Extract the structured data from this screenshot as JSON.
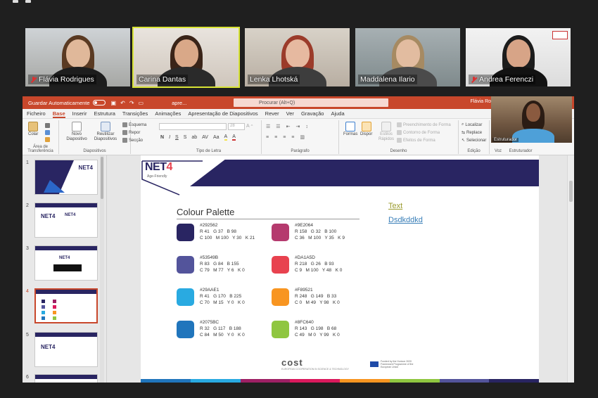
{
  "participants": [
    {
      "name": "Flávia Rodrigues",
      "muted": true
    },
    {
      "name": "Carina Dantas",
      "muted": false,
      "active": true
    },
    {
      "name": "Lenka Lhotská",
      "muted": false
    },
    {
      "name": "Maddalena Ilario",
      "muted": false
    },
    {
      "name": "Andrea Ferenczi",
      "muted": true
    }
  ],
  "ppt": {
    "autosave_label": "Guardar Automaticamente",
    "doc_name": "apre...",
    "search_placeholder": "Procurar (Alt+Q)",
    "user": "Flávia Rodrigues",
    "menu": [
      "Ficheiro",
      "Base",
      "Inserir",
      "Estrutura",
      "Transições",
      "Animações",
      "Apresentação de Diapositivos",
      "Rever",
      "Ver",
      "Gravação",
      "Ajuda"
    ],
    "active_menu": "Base",
    "ribbon": {
      "colar": "Colar",
      "clipboard_group": "Área de Transferência",
      "novo": "Novo Diapositivo",
      "reutilizar": "Reutilizar Diapositivos",
      "esquema": "Esquema",
      "repor": "Repor",
      "seccao": "Secção",
      "diapositivos_group": "Diapositivos",
      "font_size": "28",
      "tipo_letra_group": "Tipo de Letra",
      "paragrafo_group": "Parágrafo",
      "formas": "Formas",
      "dispor": "Dispor",
      "estilos": "Estilos Rápidos",
      "preenchimento": "Preenchimento de Forma",
      "contorno": "Contorno de Forma",
      "efeitos": "Efeitos de Forma",
      "desenho_group": "Desenho",
      "localizar": "Localizar",
      "replace": "Replace",
      "selecionar": "Selecionar",
      "edicao_group": "Edição",
      "voz_group": "Voz",
      "estruturador_group": "Estruturador"
    },
    "presenter_name": "Estruturador"
  },
  "thumbnails": [
    {
      "num": "1"
    },
    {
      "num": "2"
    },
    {
      "num": "3"
    },
    {
      "num": "4",
      "selected": true
    },
    {
      "num": "5"
    },
    {
      "num": "6"
    }
  ],
  "slide": {
    "logo": "NET",
    "logo_num": "4",
    "logo_sub": "Age-Friendly",
    "title": "Colour Palette",
    "link1": "Text",
    "link2": "Dsdkddkd",
    "cost_name": "cost",
    "cost_sub": "EUROPEAN COOPERATION IN SCIENCE & TECHNOLOGY",
    "eu_text": "Funded by the Horizon 2020 Framework Programme of the European Union",
    "colors": [
      {
        "hex": "#292562",
        "rgb": "R 41   G 37   B 98",
        "cmyk": "C 100   M 100   Y 30   K 21"
      },
      {
        "hex": "#9E2064",
        "rgb": "R 158   G 32   B 100",
        "cmyk": "C 36   M 100   Y 35   K 9"
      },
      {
        "hex": "#53549B",
        "rgb": "R 83   G 84   B 155",
        "cmyk": "C 79   M 77   Y 6   K 0"
      },
      {
        "hex": "#DA1A5D",
        "rgb": "R 218   G 26   B 93",
        "cmyk": "C 9   M 100   Y 48   K 0"
      },
      {
        "hex": "#29AAE1",
        "rgb": "R 41   G 170   B 225",
        "cmyk": "C 70   M 15   Y 0   K 0"
      },
      {
        "hex": "#F89521",
        "rgb": "R 248   G 149   B 33",
        "cmyk": "C 0   M 49   Y 98   K 0"
      },
      {
        "hex": "#2075BC",
        "rgb": "R 32   G 117   B 188",
        "cmyk": "C 84   M 50   Y 0   K 0"
      },
      {
        "hex": "#8FC640",
        "rgb": "R 143   G 198   B 68",
        "cmyk": "C 49   M 0   Y 99   K 0"
      }
    ],
    "swatch_fill": [
      "#292562",
      "#b53a6e",
      "#53549B",
      "#e8424f",
      "#29AAE1",
      "#F89521",
      "#2075BC",
      "#8FC640"
    ]
  },
  "theme": {
    "ppt_accent": "#c8472b",
    "navy": "#292562",
    "active_border": "#d8e436"
  }
}
